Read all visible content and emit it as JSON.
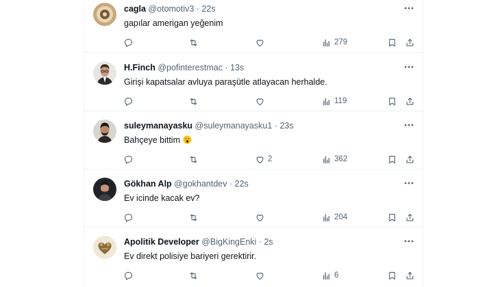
{
  "tweets": [
    {
      "name": "cagla",
      "handle": "@otomotiv3",
      "dot": "·",
      "time": "22s",
      "text": "gapılar amerigan yeğenim",
      "likes": "",
      "views": "279"
    },
    {
      "name": "H.Finch",
      "handle": "@pofinterestmac",
      "dot": "·",
      "time": "13s",
      "text": "Girişi kapatsalar avluya paraşütle atlayacan herhalde.",
      "likes": "",
      "views": "119"
    },
    {
      "name": "suleymanayasku",
      "handle": "@suleymanayasku1",
      "dot": "·",
      "time": "23s",
      "text": "Bahçeye bittim",
      "emoji": "astonished-face",
      "likes": "2",
      "views": "362"
    },
    {
      "name": "Gökhan Alp",
      "handle": "@gokhantdev",
      "dot": "·",
      "time": "22s",
      "text": "Ev icinde kacak ev?",
      "likes": "",
      "views": "204"
    },
    {
      "name": "Apolitik Developer",
      "handle": "@BigKingEnki",
      "dot": "·",
      "time": "2s",
      "text": "Ev direkt polisiye bariyeri gerektirir.",
      "likes": "",
      "views": "6"
    }
  ],
  "colors": {
    "text": "#0f1419",
    "secondary": "#536471",
    "border": "#eff3f4"
  },
  "icons": [
    "more-icon",
    "reply-icon",
    "retweet-icon",
    "like-icon",
    "views-icon",
    "bookmark-icon",
    "share-icon"
  ]
}
